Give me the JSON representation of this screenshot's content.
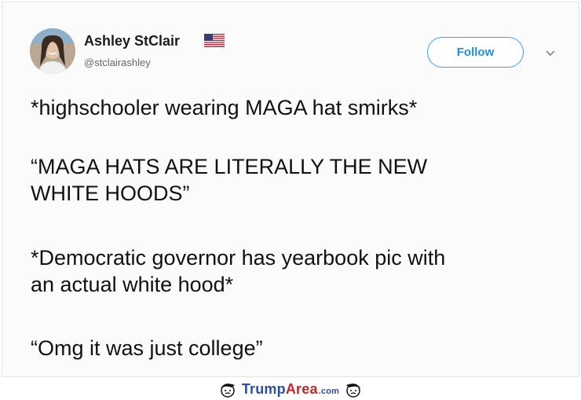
{
  "tweet": {
    "author_name": "Ashley StClair",
    "handle": "@stclairashley",
    "follow_label": "Follow",
    "paragraphs": [
      "*highschooler wearing MAGA hat smirks*",
      "“MAGA HATS ARE LITERALLY THE NEW\nWHITE HOODS”",
      "*Democratic governor has yearbook pic with\nan actual white hood*",
      "“Omg it was just college”"
    ]
  },
  "icons": {
    "flag": "us-flag-icon",
    "menu": "chevron-down-icon",
    "avatar": "profile-photo"
  },
  "watermark": {
    "brand_part1": "Trump",
    "brand_part2": "Area",
    "brand_suffix": ".com"
  },
  "colors": {
    "follow_accent": "#1d8ee3",
    "watermark_blue": "#2b4fa3",
    "watermark_red": "#c62828"
  }
}
